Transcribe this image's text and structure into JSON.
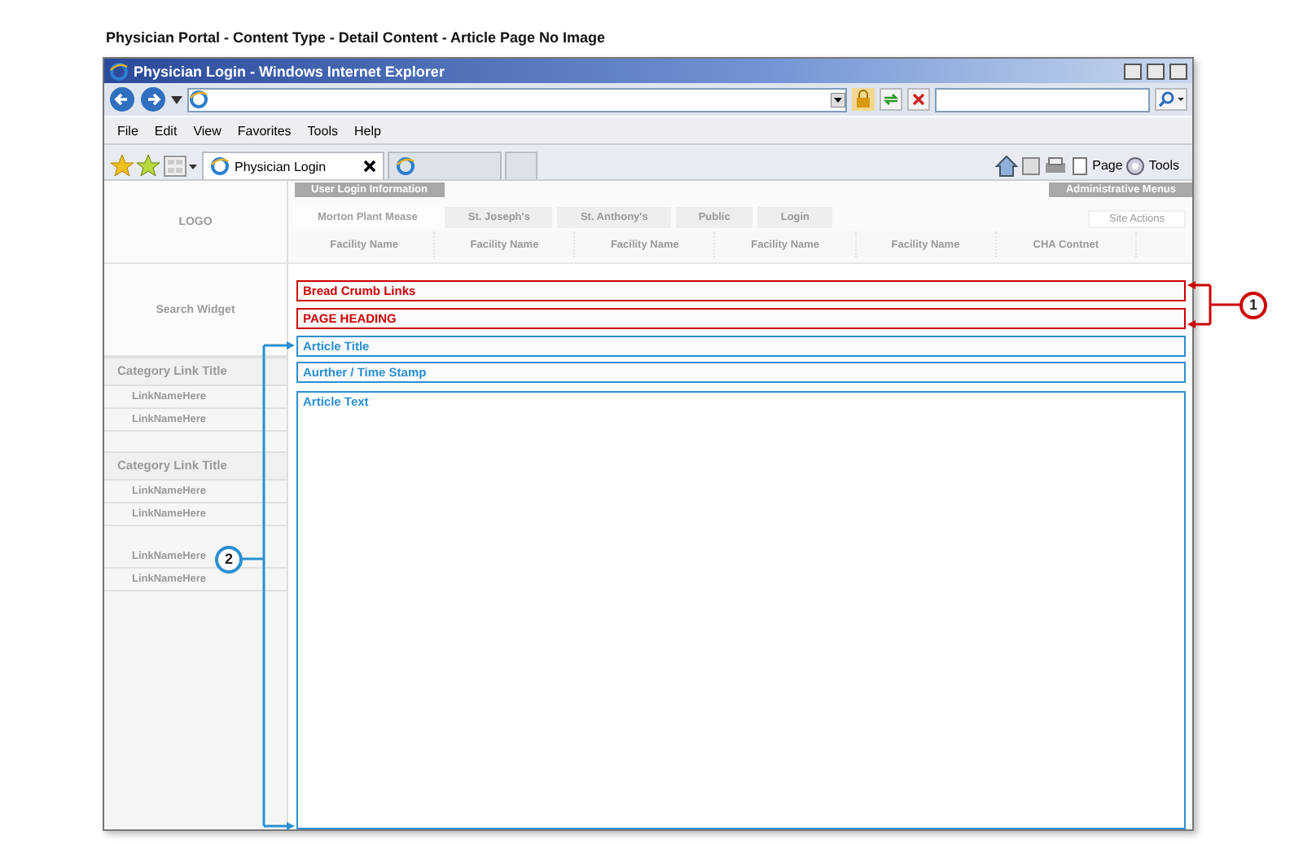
{
  "page_title": "Physician Portal - Content Type - Detail  Content - Article Page No Image",
  "browser": {
    "title": "Physician Login - Windows Internet Explorer",
    "menu": [
      "File",
      "Edit",
      "View",
      "Favorites",
      "Tools",
      "Help"
    ],
    "tabs": [
      {
        "label": "Physician Login",
        "selected": true
      },
      {
        "selected": false
      }
    ],
    "commands": [
      "Page",
      "Tools"
    ]
  },
  "wireframe": {
    "logo": "LOGO",
    "top_buttons": [
      "User Login Information",
      "Administrative Menus"
    ],
    "nav_tabs": [
      {
        "label": "Morton Plant Mease",
        "selected": true
      },
      {
        "label": "St. Joseph's",
        "selected": false
      },
      {
        "label": "St. Anthony's",
        "selected": false
      },
      {
        "label": "Public",
        "selected": false
      },
      {
        "label": "Login",
        "selected": false
      }
    ],
    "site_actions": "Site Actions",
    "facility_columns": [
      "Facility Name",
      "Facility Name",
      "Facility Name",
      "Facility Name",
      "Facility Name",
      "CHA Contnet"
    ],
    "search_widget": "Search Widget",
    "categories": [
      {
        "title": "Category Link Title",
        "links": [
          "LinkNameHere",
          "LinkNameHere"
        ]
      },
      {
        "title": "Category Link Title",
        "links": [
          "LinkNameHere",
          "LinkNameHere"
        ]
      },
      {
        "links": [
          "LinkNameHere",
          "LinkNameHere"
        ]
      }
    ],
    "regions": [
      {
        "label": "Bread Crumb Links",
        "color": "#cc0000"
      },
      {
        "label": "PAGE HEADING",
        "color": "#cc0000"
      },
      {
        "label": "Article Title",
        "color": "#2a8fd0"
      },
      {
        "label": "Aurther / Time Stamp",
        "color": "#2a8fd0"
      },
      {
        "label": "Article Text",
        "color": "#2a8fd0"
      }
    ]
  },
  "callouts": [
    {
      "number": "1",
      "color": "#cc0000"
    },
    {
      "number": "2",
      "color": "#2a8fd0"
    }
  ]
}
